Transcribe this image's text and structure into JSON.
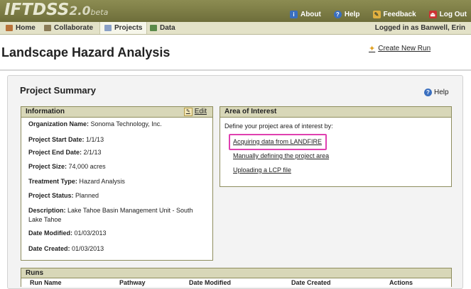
{
  "header": {
    "logo_main": "IFTDSS",
    "logo_version": "2.0",
    "logo_beta": "beta",
    "links": [
      {
        "label": "About",
        "icon": "info-icon"
      },
      {
        "label": "Help",
        "icon": "help-icon"
      },
      {
        "label": "Feedback",
        "icon": "feedback-icon"
      },
      {
        "label": "Log Out",
        "icon": "logout-icon"
      }
    ]
  },
  "nav": {
    "tabs": [
      {
        "label": "Home",
        "icon": "home-icon"
      },
      {
        "label": "Collaborate",
        "icon": "collaborate-icon"
      },
      {
        "label": "Projects",
        "icon": "projects-icon"
      },
      {
        "label": "Data",
        "icon": "data-icon"
      }
    ],
    "active_tab": "Projects",
    "logged_in": "Logged in as Banwell, Erin"
  },
  "page": {
    "title": "Landscape Hazard Analysis",
    "create_run": "Create New Run"
  },
  "summary": {
    "title": "Project Summary",
    "help": "Help"
  },
  "info": {
    "heading": "Information",
    "edit": "Edit",
    "rows": [
      {
        "label": "Organization Name:",
        "value": "Sonoma Technology, Inc."
      },
      {
        "label": "Project Start Date:",
        "value": "1/1/13"
      },
      {
        "label": "Project End Date:",
        "value": "2/1/13"
      },
      {
        "label": "Project Size:",
        "value": "74,000 acres"
      },
      {
        "label": "Treatment Type:",
        "value": "Hazard Analysis"
      },
      {
        "label": "Project Status:",
        "value": "Planned"
      },
      {
        "label": "Description:",
        "value": "Lake Tahoe Basin Management Unit - South Lake Tahoe"
      },
      {
        "label": "Date Modified:",
        "value": "01/03/2013"
      },
      {
        "label": "Date Created:",
        "value": "01/03/2013"
      }
    ]
  },
  "aoi": {
    "heading": "Area of Interest",
    "intro": "Define your project area of interest by:",
    "links": [
      "Acquiring data from LANDFIRE",
      "Manually defining the project area",
      "Uploading a LCP file"
    ]
  },
  "runs": {
    "heading": "Runs",
    "columns": [
      "Run Name",
      "Pathway",
      "Date Modified",
      "Date Created",
      "Actions"
    ]
  },
  "colors": {
    "header": "#7d7d45",
    "nav": "#e3e2c8",
    "panel_head": "#d8d7b8",
    "highlight": "#e040b0"
  }
}
